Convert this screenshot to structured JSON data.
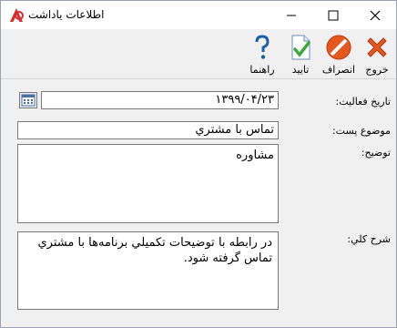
{
  "window": {
    "title": "اطلاعات یاداشت",
    "accent": "#d92b2b"
  },
  "toolbar": {
    "exit_label": "خروج",
    "cancel_label": "انصراف",
    "confirm_label": "تایید",
    "help_label": "راهنما"
  },
  "form": {
    "activity_date_label": "تاریخ فعالیت:",
    "activity_date_value": "۱۳۹۹/۰۴/۲۳",
    "subject_label": "موضوع پست:",
    "subject_value": "تماس با مشتري",
    "description_label": "توضیح:",
    "description_value": "مشاوره",
    "summary_label": "شرح کلي:",
    "summary_value": "در رابطه با توضيحات تکميلي برنامه‌ها با مشتري تماس گرفته شود."
  },
  "icons": {
    "app": "app-logo-icon",
    "exit": "close-x-icon",
    "cancel": "no-entry-icon",
    "confirm": "document-check-icon",
    "help": "question-mark-icon",
    "calendar": "calendar-icon"
  }
}
